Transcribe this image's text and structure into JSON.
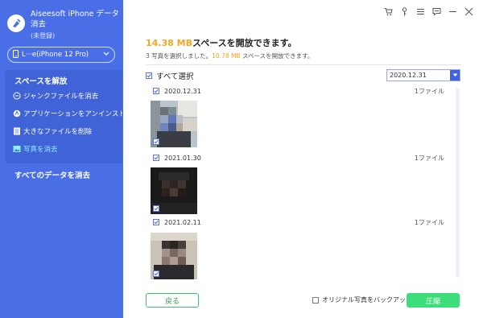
{
  "app": {
    "title": "Aiseesoft iPhone データ消去",
    "status": "(未登録)",
    "device": "L···e(iPhone 12 Pro)"
  },
  "sidebar": {
    "section_title": "スペースを解放",
    "items": [
      {
        "label": "ジャンクファイルを消去",
        "icon": "broom-icon"
      },
      {
        "label": "アプリケーションをアンインストール",
        "icon": "app-icon"
      },
      {
        "label": "大きなファイルを削除",
        "icon": "file-icon"
      },
      {
        "label": "写真を消去",
        "icon": "photo-icon",
        "active": true
      }
    ],
    "erase_all": "すべてのデータを消去"
  },
  "titlebar": {
    "icons": [
      "cart-icon",
      "key-icon",
      "menu-icon",
      "feedback-icon",
      "minimize-icon",
      "close-icon"
    ]
  },
  "main": {
    "headline_size": "14.38 MB",
    "headline_text": "スペースを開放できます。",
    "sub_prefix": "3 写真を選択しました。",
    "sub_size": "10.78 MB",
    "sub_suffix": " スペースを開放できます。",
    "select_all": "すべて選択",
    "date_filter": "2020.12.31",
    "groups": [
      {
        "date": "2020.12.31",
        "count": "1ファイル"
      },
      {
        "date": "2021.01.30",
        "count": "1ファイル"
      },
      {
        "date": "2021.02.11",
        "count": "1ファイル"
      }
    ],
    "back": "戻る",
    "backup": "オリジナル写真をバックアップ",
    "compress": "圧縮"
  },
  "colors": {
    "sidebar": "#4a6ee6",
    "accent_orange": "#f5a623",
    "primary_blue": "#3d63e0",
    "green": "#3cde7a"
  }
}
